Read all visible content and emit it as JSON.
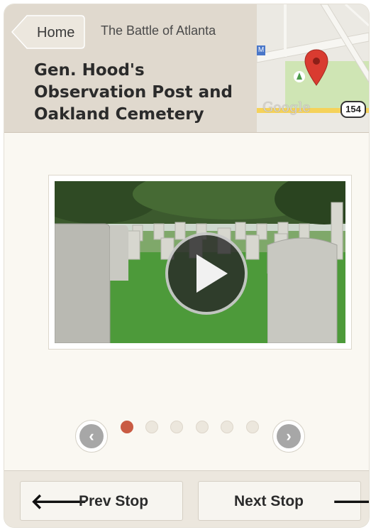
{
  "header": {
    "home_label": "Home",
    "app_title": "The Battle of Atlanta",
    "stop_title": "Gen. Hood's Observation Post and Oakland Cemetery"
  },
  "map": {
    "brand": "Google",
    "route_shield": "154",
    "marker_letter": "M",
    "pin_color": "#d93b30"
  },
  "video": {
    "play_icon": "play-icon"
  },
  "pager": {
    "total": 6,
    "active_index": 0,
    "active_color": "#c95b43",
    "prev_icon": "chevron-left-icon",
    "next_icon": "chevron-right-icon",
    "prev_glyph": "‹",
    "next_glyph": "›"
  },
  "footer": {
    "prev_label": "Prev Stop",
    "next_label": "Next Stop",
    "prev_arrow": "🡐",
    "next_arrow": "🡒"
  }
}
